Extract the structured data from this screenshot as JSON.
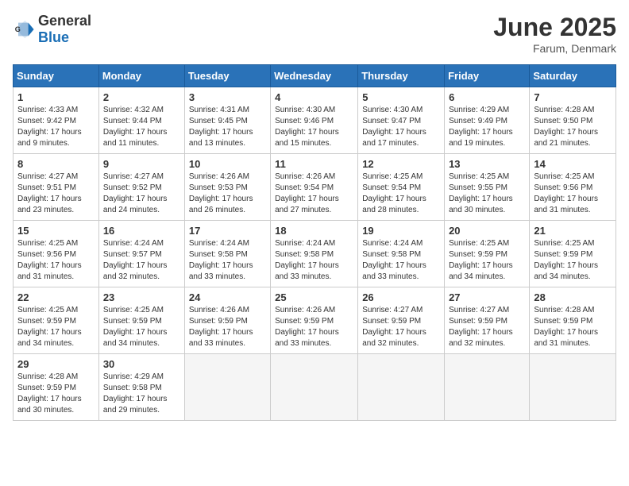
{
  "logo": {
    "text_general": "General",
    "text_blue": "Blue"
  },
  "title": "June 2025",
  "location": "Farum, Denmark",
  "days_of_week": [
    "Sunday",
    "Monday",
    "Tuesday",
    "Wednesday",
    "Thursday",
    "Friday",
    "Saturday"
  ],
  "weeks": [
    [
      {
        "day": "1",
        "sunrise": "4:33 AM",
        "sunset": "9:42 PM",
        "daylight": "17 hours and 9 minutes."
      },
      {
        "day": "2",
        "sunrise": "4:32 AM",
        "sunset": "9:44 PM",
        "daylight": "17 hours and 11 minutes."
      },
      {
        "day": "3",
        "sunrise": "4:31 AM",
        "sunset": "9:45 PM",
        "daylight": "17 hours and 13 minutes."
      },
      {
        "day": "4",
        "sunrise": "4:30 AM",
        "sunset": "9:46 PM",
        "daylight": "17 hours and 15 minutes."
      },
      {
        "day": "5",
        "sunrise": "4:30 AM",
        "sunset": "9:47 PM",
        "daylight": "17 hours and 17 minutes."
      },
      {
        "day": "6",
        "sunrise": "4:29 AM",
        "sunset": "9:49 PM",
        "daylight": "17 hours and 19 minutes."
      },
      {
        "day": "7",
        "sunrise": "4:28 AM",
        "sunset": "9:50 PM",
        "daylight": "17 hours and 21 minutes."
      }
    ],
    [
      {
        "day": "8",
        "sunrise": "4:27 AM",
        "sunset": "9:51 PM",
        "daylight": "17 hours and 23 minutes."
      },
      {
        "day": "9",
        "sunrise": "4:27 AM",
        "sunset": "9:52 PM",
        "daylight": "17 hours and 24 minutes."
      },
      {
        "day": "10",
        "sunrise": "4:26 AM",
        "sunset": "9:53 PM",
        "daylight": "17 hours and 26 minutes."
      },
      {
        "day": "11",
        "sunrise": "4:26 AM",
        "sunset": "9:54 PM",
        "daylight": "17 hours and 27 minutes."
      },
      {
        "day": "12",
        "sunrise": "4:25 AM",
        "sunset": "9:54 PM",
        "daylight": "17 hours and 28 minutes."
      },
      {
        "day": "13",
        "sunrise": "4:25 AM",
        "sunset": "9:55 PM",
        "daylight": "17 hours and 30 minutes."
      },
      {
        "day": "14",
        "sunrise": "4:25 AM",
        "sunset": "9:56 PM",
        "daylight": "17 hours and 31 minutes."
      }
    ],
    [
      {
        "day": "15",
        "sunrise": "4:25 AM",
        "sunset": "9:56 PM",
        "daylight": "17 hours and 31 minutes."
      },
      {
        "day": "16",
        "sunrise": "4:24 AM",
        "sunset": "9:57 PM",
        "daylight": "17 hours and 32 minutes."
      },
      {
        "day": "17",
        "sunrise": "4:24 AM",
        "sunset": "9:58 PM",
        "daylight": "17 hours and 33 minutes."
      },
      {
        "day": "18",
        "sunrise": "4:24 AM",
        "sunset": "9:58 PM",
        "daylight": "17 hours and 33 minutes."
      },
      {
        "day": "19",
        "sunrise": "4:24 AM",
        "sunset": "9:58 PM",
        "daylight": "17 hours and 33 minutes."
      },
      {
        "day": "20",
        "sunrise": "4:25 AM",
        "sunset": "9:59 PM",
        "daylight": "17 hours and 34 minutes."
      },
      {
        "day": "21",
        "sunrise": "4:25 AM",
        "sunset": "9:59 PM",
        "daylight": "17 hours and 34 minutes."
      }
    ],
    [
      {
        "day": "22",
        "sunrise": "4:25 AM",
        "sunset": "9:59 PM",
        "daylight": "17 hours and 34 minutes."
      },
      {
        "day": "23",
        "sunrise": "4:25 AM",
        "sunset": "9:59 PM",
        "daylight": "17 hours and 34 minutes."
      },
      {
        "day": "24",
        "sunrise": "4:26 AM",
        "sunset": "9:59 PM",
        "daylight": "17 hours and 33 minutes."
      },
      {
        "day": "25",
        "sunrise": "4:26 AM",
        "sunset": "9:59 PM",
        "daylight": "17 hours and 33 minutes."
      },
      {
        "day": "26",
        "sunrise": "4:27 AM",
        "sunset": "9:59 PM",
        "daylight": "17 hours and 32 minutes."
      },
      {
        "day": "27",
        "sunrise": "4:27 AM",
        "sunset": "9:59 PM",
        "daylight": "17 hours and 32 minutes."
      },
      {
        "day": "28",
        "sunrise": "4:28 AM",
        "sunset": "9:59 PM",
        "daylight": "17 hours and 31 minutes."
      }
    ],
    [
      {
        "day": "29",
        "sunrise": "4:28 AM",
        "sunset": "9:59 PM",
        "daylight": "17 hours and 30 minutes."
      },
      {
        "day": "30",
        "sunrise": "4:29 AM",
        "sunset": "9:58 PM",
        "daylight": "17 hours and 29 minutes."
      },
      null,
      null,
      null,
      null,
      null
    ]
  ]
}
